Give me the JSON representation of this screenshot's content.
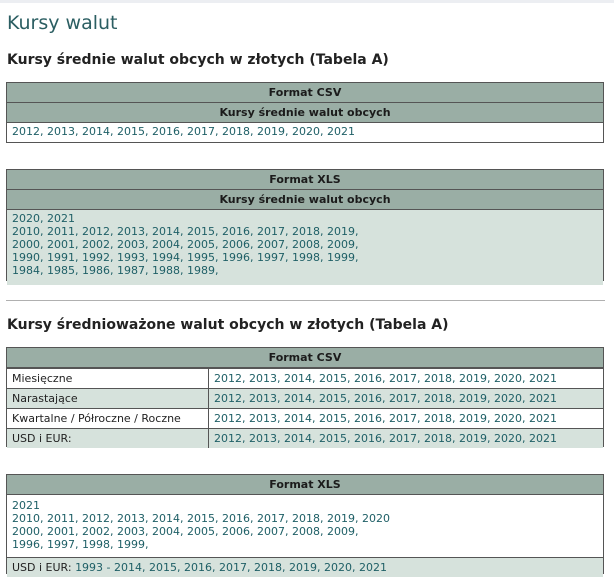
{
  "page": {
    "title": "Kursy walut"
  },
  "section1": {
    "title": "Kursy średnie walut obcych w złotych (Tabela A)",
    "csv": {
      "header": "Format CSV",
      "subheader": "Kursy średnie walut obcych",
      "years": [
        "2012",
        "2013",
        "2014",
        "2015",
        "2016",
        "2017",
        "2018",
        "2019",
        "2020",
        "2021"
      ]
    },
    "xls": {
      "header": "Format XLS",
      "subheader": "Kursy średnie walut obcych",
      "rows": [
        [
          "2020",
          "2021"
        ],
        [
          "2010",
          "2011",
          "2012",
          "2013",
          "2014",
          "2015",
          "2016",
          "2017",
          "2018",
          "2019"
        ],
        [
          "2000",
          "2001",
          "2002",
          "2003",
          "2004",
          "2005",
          "2006",
          "2007",
          "2008",
          "2009"
        ],
        [
          "1990",
          "1991",
          "1992",
          "1993",
          "1994",
          "1995",
          "1996",
          "1997",
          "1998",
          "1999"
        ],
        [
          "1984",
          "1985",
          "1986",
          "1987",
          "1988",
          "1989"
        ]
      ]
    }
  },
  "section2": {
    "title": "Kursy średnioważone walut obcych w złotych (Tabela A)",
    "csv": {
      "header": "Format CSV",
      "rows": [
        {
          "label": "Miesięczne",
          "years": [
            "2012",
            "2013",
            "2014",
            "2015",
            "2016",
            "2017",
            "2018",
            "2019",
            "2020",
            "2021"
          ]
        },
        {
          "label": "Narastające",
          "years": [
            "2012",
            "2013",
            "2014",
            "2015",
            "2016",
            "2017",
            "2018",
            "2019",
            "2020",
            "2021"
          ]
        },
        {
          "label": "Kwartalne / Półroczne / Roczne",
          "years": [
            "2012",
            "2013",
            "2014",
            "2015",
            "2016",
            "2017",
            "2018",
            "2019",
            "2020",
            "2021"
          ]
        },
        {
          "label": "USD i EUR:",
          "years": [
            "2012",
            "2013",
            "2014",
            "2015",
            "2016",
            "2017",
            "2018",
            "2019",
            "2020",
            "2021"
          ]
        }
      ]
    },
    "xls": {
      "header": "Format XLS",
      "rows": [
        [
          "2021"
        ],
        [
          "2010",
          "2011",
          "2012",
          "2013",
          "2014",
          "2015",
          "2016",
          "2017",
          "2018",
          "2019",
          "2020"
        ],
        [
          "2000",
          "2001",
          "2002",
          "2003",
          "2004",
          "2005",
          "2006",
          "2007",
          "2008",
          "2009"
        ],
        [
          "1996",
          "1997",
          "1998",
          "1999"
        ]
      ],
      "usd_label": "USD i EUR:",
      "usd_links": [
        "1993 - 2014",
        "2015",
        "2016",
        "2017",
        "2018",
        "2019",
        "2020",
        "2021"
      ]
    }
  },
  "colors": {
    "header_bg": "#9aaea5",
    "row_alt_bg": "#d6e2dc",
    "link": "#1e5f66",
    "title": "#2b5e62"
  }
}
